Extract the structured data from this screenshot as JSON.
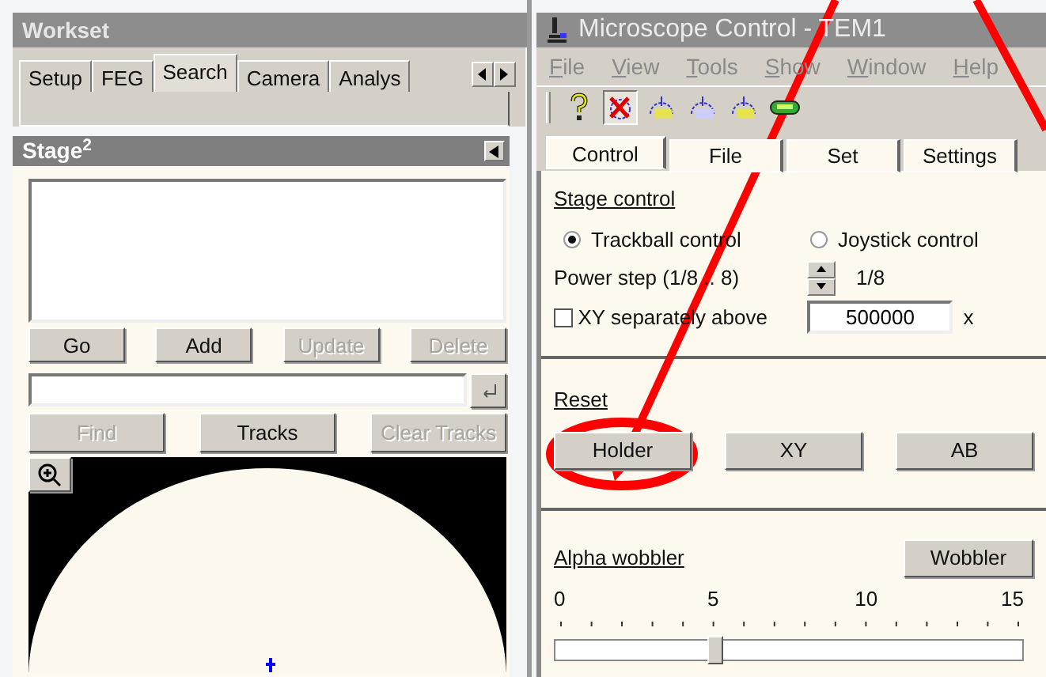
{
  "workset": {
    "title": "Workset",
    "tabs": [
      {
        "label": "Setup",
        "selected": false
      },
      {
        "label": "FEG",
        "selected": false
      },
      {
        "label": "Search",
        "selected": true
      },
      {
        "label": "Camera",
        "selected": false
      },
      {
        "label": "Analys",
        "selected": false
      }
    ]
  },
  "stage": {
    "title": "Stage$^{2}$",
    "buttons": [
      {
        "label": "Go",
        "disabled": false
      },
      {
        "label": "Add",
        "disabled": false
      },
      {
        "label": "Update",
        "disabled": true
      },
      {
        "label": "Delete",
        "disabled": true
      }
    ],
    "track_buttons": [
      {
        "label": "Find",
        "disabled": true
      },
      {
        "label": "Tracks",
        "disabled": false
      },
      {
        "label": "Clear Tracks",
        "disabled": true
      }
    ]
  },
  "microscope": {
    "title": "Microscope Control - TEM1",
    "menu": [
      "File",
      "View",
      "Tools",
      "Show",
      "Window",
      "Help"
    ],
    "toolbar": [
      {
        "kind": "help",
        "selected": false
      },
      {
        "kind": "stage",
        "selected": true
      },
      {
        "kind": "c2",
        "selected": false
      },
      {
        "kind": "obj",
        "selected": false
      },
      {
        "kind": "diff",
        "selected": false
      },
      {
        "kind": "lamp",
        "selected": false
      }
    ],
    "tabs": [
      {
        "label": "Control",
        "selected": true
      },
      {
        "label": "File",
        "selected": false
      },
      {
        "label": "Set",
        "selected": false
      },
      {
        "label": "Settings",
        "selected": false
      }
    ],
    "stage_control": {
      "heading": "Stage control",
      "radios": [
        {
          "label": "Trackball control",
          "selected": true
        },
        {
          "label": "Joystick control",
          "selected": false
        }
      ],
      "power_step_label": "Power step (1/8 .. 8)",
      "power_step_value": "1/8",
      "xy_separately": {
        "label": "XY separately above",
        "checked": false
      },
      "xy_value": "500000",
      "xy_unit": "x"
    },
    "reset": {
      "heading": "Reset",
      "buttons": [
        "Holder",
        "XY",
        "AB"
      ]
    },
    "alpha_wobbler": {
      "heading": "Alpha wobbler",
      "button": "Wobbler",
      "scale": [
        "0",
        "5",
        "10",
        "15"
      ],
      "level": 0.333
    }
  }
}
